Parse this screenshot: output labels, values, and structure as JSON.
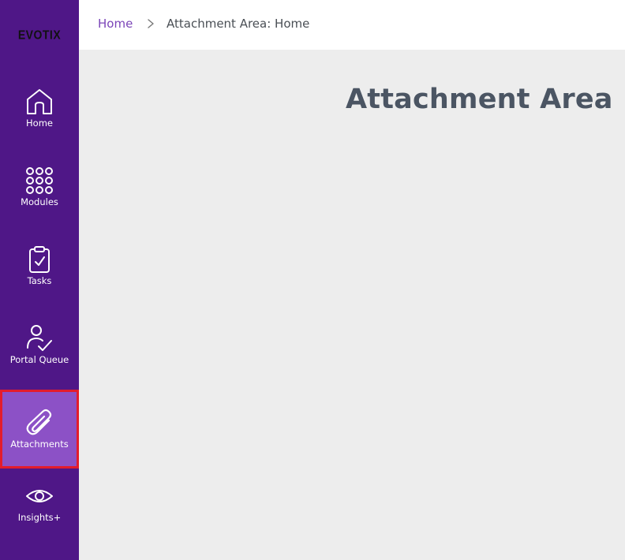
{
  "app": {
    "logo_text": "EVOTIX"
  },
  "sidebar": {
    "items": [
      {
        "label": "Home",
        "icon": "home-icon"
      },
      {
        "label": "Modules",
        "icon": "grid-dots-icon"
      },
      {
        "label": "Tasks",
        "icon": "clipboard-check-icon"
      },
      {
        "label": "Portal Queue",
        "icon": "user-check-icon"
      },
      {
        "label": "Attachments",
        "icon": "paperclip-icon",
        "active": true
      },
      {
        "label": "Insights+",
        "icon": "eye-icon"
      }
    ],
    "colors": {
      "background": "#4f1787",
      "active_background": "#8c51c6",
      "highlight_border": "#e31c2c"
    }
  },
  "breadcrumb": {
    "home": "Home",
    "current": "Attachment Area: Home"
  },
  "main": {
    "title": "Attachment Area"
  }
}
